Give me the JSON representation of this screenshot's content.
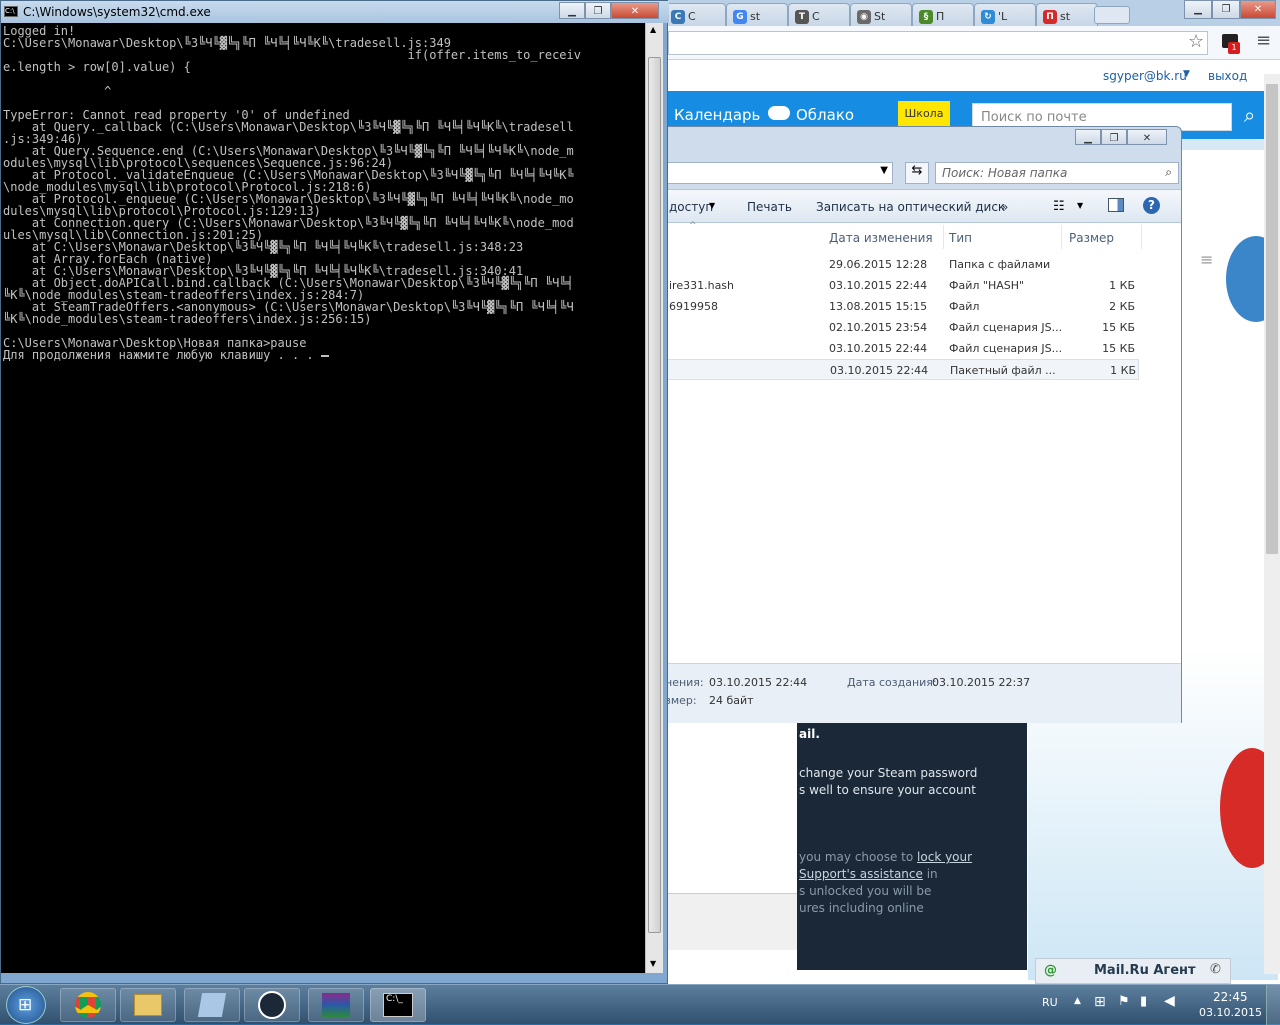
{
  "cmd": {
    "title": "C:\\Windows\\system32\\cmd.exe",
    "lines": [
      "Logged in!",
      "C:\\Users\\Monawar\\Desktop\\╚З╚Ч╚▓╚╗╚П ╚Ч╚╡╚Ч╚К╚\\tradesell.js:349",
      "                                                        if(offer.items_to_receiv",
      "e.length > row[0].value) {",
      "",
      "              ^",
      "",
      "TypeError: Cannot read property '0' of undefined",
      "    at Query._callback (C:\\Users\\Monawar\\Desktop\\╚З╚Ч╚▓╚╗╚П ╚Ч╚╡╚Ч╚К╚\\tradesell",
      ".js:349:46)",
      "    at Query.Sequence.end (C:\\Users\\Monawar\\Desktop\\╚З╚Ч╚▓╚╗╚П ╚Ч╚╡╚Ч╚К╚\\node_m",
      "odules\\mysql\\lib\\protocol\\sequences\\Sequence.js:96:24)",
      "    at Protocol._validateEnqueue (C:\\Users\\Monawar\\Desktop\\╚З╚Ч╚▓╚╗╚П ╚Ч╚╡╚Ч╚К╚",
      "\\node_modules\\mysql\\lib\\protocol\\Protocol.js:218:6)",
      "    at Protocol._enqueue (C:\\Users\\Monawar\\Desktop\\╚З╚Ч╚▓╚╗╚П ╚Ч╚╡╚Ч╚К╚\\node_mo",
      "dules\\mysql\\lib\\protocol\\Protocol.js:129:13)",
      "    at Connection.query (C:\\Users\\Monawar\\Desktop\\╚З╚Ч╚▓╚╗╚П ╚Ч╚╡╚Ч╚К╚\\node_mod",
      "ules\\mysql\\lib\\Connection.js:201:25)",
      "    at C:\\Users\\Monawar\\Desktop\\╚З╚Ч╚▓╚╗╚П ╚Ч╚╡╚Ч╚К╚\\tradesell.js:348:23",
      "    at Array.forEach (native)",
      "    at C:\\Users\\Monawar\\Desktop\\╚З╚Ч╚▓╚╗╚П ╚Ч╚╡╚Ч╚К╚\\tradesell.js:340:41",
      "    at Object.doAPICall.bind.callback (C:\\Users\\Monawar\\Desktop\\╚З╚Ч╚▓╚╗╚П ╚Ч╚╡",
      "╚К╚\\node_modules\\steam-tradeoffers\\index.js:284:7)",
      "    at SteamTradeOffers.<anonymous> (C:\\Users\\Monawar\\Desktop\\╚З╚Ч╚▓╚╗╚П ╚Ч╚╡╚Ч",
      "╚К╚\\node_modules\\steam-tradeoffers\\index.js:256:15)",
      "",
      "C:\\Users\\Monawar\\Desktop\\Новая папка>pause"
    ],
    "last_line": "Для продолжения нажмите любую клавишу . . . "
  },
  "browser": {
    "tabs": [
      {
        "label": "С",
        "color": "#3b78b6",
        "glyph": "С"
      },
      {
        "label": "st",
        "color": "#4285f4",
        "glyph": "G"
      },
      {
        "label": "С",
        "color": "#555555",
        "glyph": "T"
      },
      {
        "label": "St",
        "color": "#6a6a6a",
        "glyph": "◉"
      },
      {
        "label": "П",
        "color": "#4b8a2a",
        "glyph": "§"
      },
      {
        "label": "'L",
        "color": "#2f8bd6",
        "glyph": "↻"
      },
      {
        "label": "st",
        "color": "#d42a2a",
        "glyph": "П"
      }
    ],
    "user_email": "sgyper@bk.ru",
    "logout": "выход",
    "nav_calendar": "Календарь",
    "nav_cloud": "Облако",
    "school_badge": "Школа",
    "search_placeholder": "Поиск по почте",
    "extension_badge": "1",
    "steam_text": {
      "heading": "ail.",
      "p1": "change your Steam password",
      "p2": "s well to ensure your account",
      "p3": "you may choose to",
      "p3_link": "lock your",
      "p4_link": "Support's assistance",
      "p4": " in",
      "p5": "s unlocked you will be",
      "p6": "ures including online"
    },
    "agent_label": "Mail.Ru Агент"
  },
  "explorer": {
    "search_placeholder": "Поиск: Новая папка",
    "commands": {
      "access": "доступ",
      "print": "Печать",
      "burn": "Записать на оптический диск",
      "more": "»"
    },
    "columns": {
      "name": "",
      "modified": "Дата изменения",
      "type": "Тип",
      "size": "Размер"
    },
    "files": [
      {
        "name": "",
        "modified": "29.06.2015 12:28",
        "type": "Папка с файлами",
        "size": ""
      },
      {
        "name": "ire331.hash",
        "modified": "03.10.2015 22:44",
        "type": "Файл \"HASH\"",
        "size": "1 КБ"
      },
      {
        "name": "6919958",
        "modified": "13.08.2015 15:15",
        "type": "Файл",
        "size": "2 КБ"
      },
      {
        "name": "",
        "modified": "02.10.2015 23:54",
        "type": "Файл сценария JS...",
        "size": "15 КБ"
      },
      {
        "name": "",
        "modified": "03.10.2015 22:44",
        "type": "Файл сценария JS...",
        "size": "15 КБ"
      },
      {
        "name": "",
        "modified": "03.10.2015 22:44",
        "type": "Пакетный файл ...",
        "size": "1 КБ"
      }
    ],
    "details": {
      "modified_label": "нения:",
      "modified_value": "03.10.2015 22:44",
      "created_label": "Дата создания:",
      "created_value": "03.10.2015 22:37",
      "size_label": "змер:",
      "size_value": "24 байт"
    }
  },
  "taskbar": {
    "lang": "RU",
    "time": "22:45",
    "date": "03.10.2015"
  }
}
